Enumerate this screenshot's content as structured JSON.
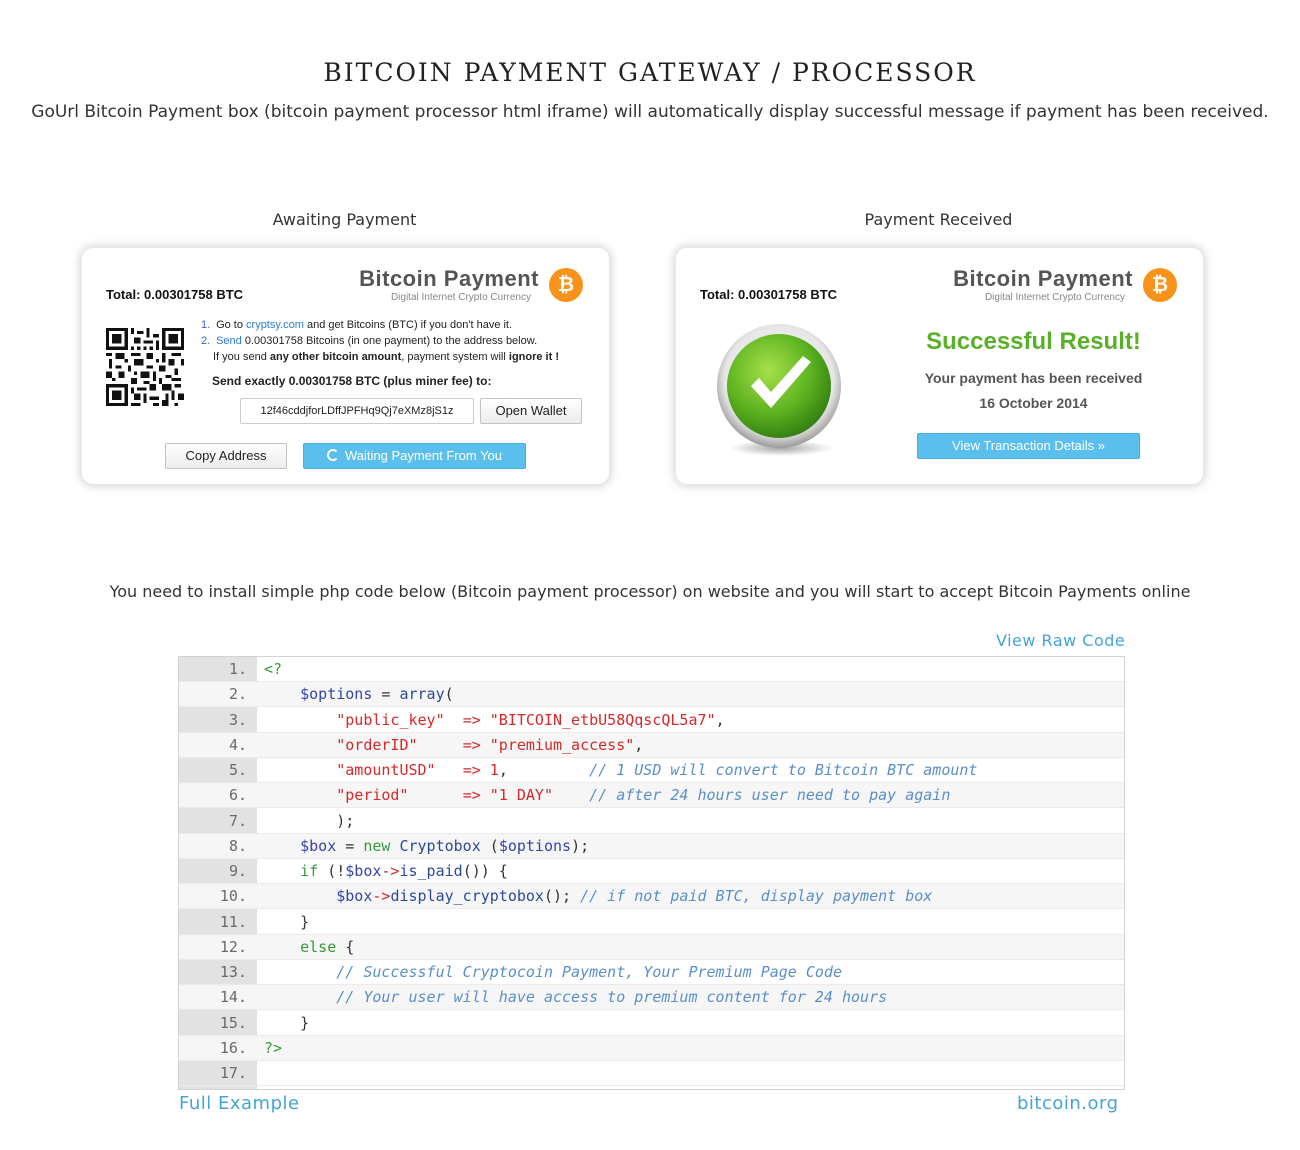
{
  "header": {
    "title": "BITCOIN PAYMENT GATEWAY / PROCESSOR",
    "intro": "GoUrl Bitcoin Payment box (bitcoin payment processor html iframe) will automatically display successful message if payment has been received."
  },
  "awaiting": {
    "caption": "Awaiting Payment",
    "total_label": "Total:",
    "total_value": "0.00301758 BTC",
    "brand_name": "Bitcoin Payment",
    "brand_tagline": "Digital Internet Crypto Currency",
    "step1_num": "1.",
    "step1_pre": "Go to",
    "step1_link": "cryptsy.com",
    "step1_post": "and get Bitcoins (BTC) if you don't have it.",
    "step2_num": "2.",
    "step2_link": "Send",
    "step2_post": "0.00301758 Bitcoins (in one payment) to the address below.",
    "warn_pre": "If you send",
    "warn_bold1": "any other bitcoin amount",
    "warn_mid": ", payment system will",
    "warn_bold2": "ignore it !",
    "send_exact": "Send exactly 0.00301758 BTC (plus miner fee) to:",
    "address": "12f46cddjforLDffJPFHq9Qj7eXMz8jS1z",
    "open_wallet": "Open Wallet",
    "copy_address": "Copy Address",
    "waiting": "Waiting Payment From You"
  },
  "received": {
    "caption": "Payment Received",
    "total_label": "Total:",
    "total_value": "0.00301758 BTC",
    "brand_name": "Bitcoin Payment",
    "brand_tagline": "Digital Internet Crypto Currency",
    "success_title": "Successful Result!",
    "line1": "Your payment has been received",
    "date": "16 October 2014",
    "button": "View Transaction Details »"
  },
  "code_section": {
    "install_note": "You need to install simple php code below (Bitcoin payment processor) on website and you will start to accept Bitcoin Payments online",
    "view_raw": "View Raw Code",
    "lines": [
      [
        [
          "kw",
          "<?"
        ]
      ],
      [
        [
          "pun",
          "    "
        ],
        [
          "var",
          "$options"
        ],
        [
          "pun",
          " = "
        ],
        [
          "fn",
          "array"
        ],
        [
          "pun",
          "("
        ]
      ],
      [
        [
          "pun",
          "        "
        ],
        [
          "str",
          "\"public_key\""
        ],
        [
          "pun",
          "  "
        ],
        [
          "op",
          "=>"
        ],
        [
          "pun",
          " "
        ],
        [
          "str",
          "\"BITCOIN_etbU58QqscQL5a7\""
        ],
        [
          "pun",
          ","
        ]
      ],
      [
        [
          "pun",
          "        "
        ],
        [
          "str",
          "\"orderID\""
        ],
        [
          "pun",
          "     "
        ],
        [
          "op",
          "=>"
        ],
        [
          "pun",
          " "
        ],
        [
          "str",
          "\"premium_access\""
        ],
        [
          "pun",
          ","
        ]
      ],
      [
        [
          "pun",
          "        "
        ],
        [
          "str",
          "\"amountUSD\""
        ],
        [
          "pun",
          "   "
        ],
        [
          "op",
          "=>"
        ],
        [
          "pun",
          " "
        ],
        [
          "str",
          "1"
        ],
        [
          "pun",
          ",         "
        ],
        [
          "cm",
          "// 1 USD will convert to Bitcoin BTC amount"
        ]
      ],
      [
        [
          "pun",
          "        "
        ],
        [
          "str",
          "\"period\""
        ],
        [
          "pun",
          "      "
        ],
        [
          "op",
          "=>"
        ],
        [
          "pun",
          " "
        ],
        [
          "str",
          "\"1 DAY\""
        ],
        [
          "pun",
          "    "
        ],
        [
          "cm",
          "// after 24 hours user need to pay again"
        ]
      ],
      [
        [
          "pun",
          "        );"
        ]
      ],
      [
        [
          "pun",
          "    "
        ],
        [
          "var",
          "$box"
        ],
        [
          "pun",
          " = "
        ],
        [
          "kw",
          "new"
        ],
        [
          "pun",
          " "
        ],
        [
          "fn",
          "Cryptobox"
        ],
        [
          "pun",
          " ("
        ],
        [
          "var",
          "$options"
        ],
        [
          "pun",
          ");"
        ]
      ],
      [
        [
          "pun",
          "    "
        ],
        [
          "kw",
          "if"
        ],
        [
          "pun",
          " (!"
        ],
        [
          "var",
          "$box"
        ],
        [
          "op",
          "->"
        ],
        [
          "fn",
          "is_paid"
        ],
        [
          "pun",
          "()) {"
        ]
      ],
      [
        [
          "pun",
          "        "
        ],
        [
          "var",
          "$box"
        ],
        [
          "op",
          "->"
        ],
        [
          "fn",
          "display_cryptobox"
        ],
        [
          "pun",
          "(); "
        ],
        [
          "cm",
          "// if not paid BTC, display payment box"
        ]
      ],
      [
        [
          "pun",
          "    }"
        ]
      ],
      [
        [
          "pun",
          "    "
        ],
        [
          "kw",
          "else"
        ],
        [
          "pun",
          " {"
        ]
      ],
      [
        [
          "pun",
          "        "
        ],
        [
          "cm",
          "// Successful Cryptocoin Payment, Your Premium Page Code"
        ]
      ],
      [
        [
          "pun",
          "        "
        ],
        [
          "cm",
          "// Your user will have access to premium content for 24 hours"
        ]
      ],
      [
        [
          "pun",
          "    }"
        ]
      ],
      [
        [
          "kw",
          "?>"
        ]
      ],
      []
    ],
    "full_example": "Full Example",
    "bitcoin_org": "bitcoin.org"
  },
  "colors": {
    "link_blue": "#44a4d6",
    "button_blue": "#5bbfee",
    "success_green": "#5ab02a",
    "btc_orange": "#f7931a"
  }
}
